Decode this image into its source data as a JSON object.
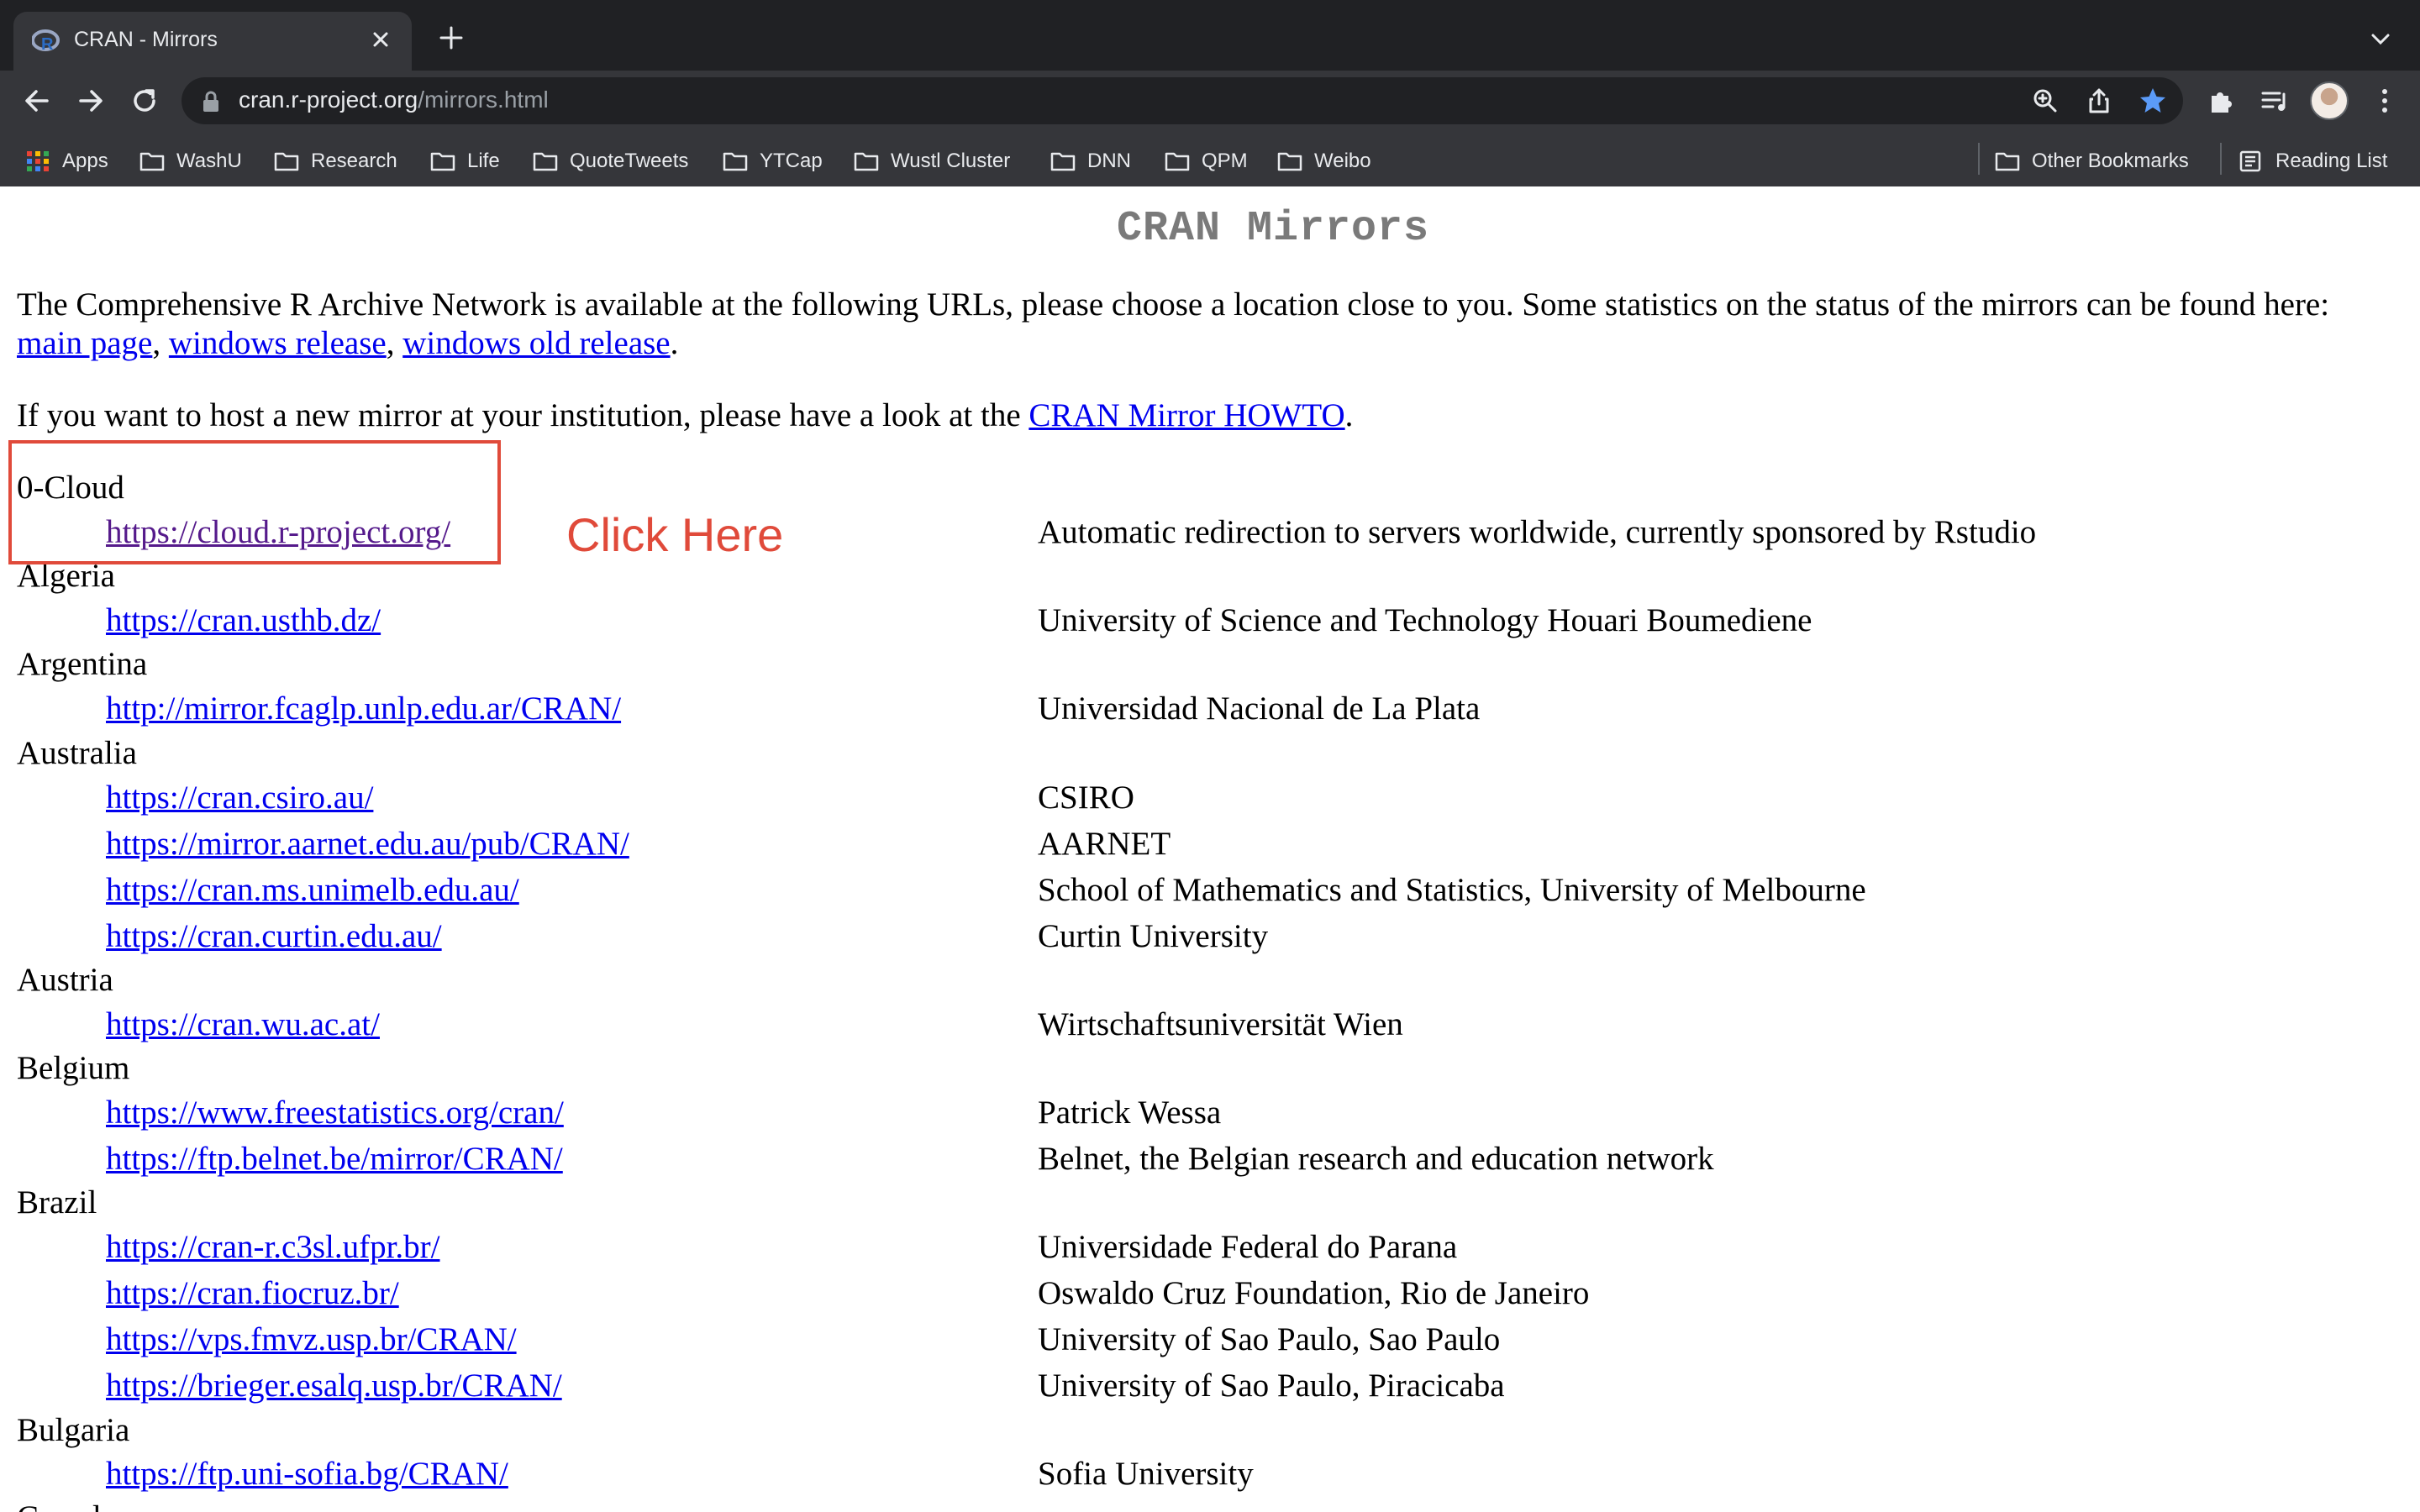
{
  "browser": {
    "tab_title": "CRAN - Mirrors",
    "url_host": "cran.r-project.org",
    "url_path": "/mirrors.html",
    "bookmarks": [
      "Apps",
      "WashU",
      "Research",
      "Life",
      "QuoteTweets",
      "YTCap",
      "Wustl Cluster",
      "DNN",
      "QPM",
      "Weibo"
    ],
    "other_bookmarks": "Other Bookmarks",
    "reading_list": "Reading List"
  },
  "page": {
    "title": "CRAN Mirrors",
    "intro_text": "The Comprehensive R Archive Network is available at the following URLs, please choose a location close to you. Some statistics on the status of the mirrors can be found here:",
    "stats_links": [
      "main page",
      "windows release",
      "windows old release"
    ],
    "howto_prefix": "If you want to host a new mirror at your institution, please have a look at the",
    "howto_link": "CRAN Mirror HOWTO",
    "annotation": "Click Here"
  },
  "mirrors": [
    {
      "country": "0-Cloud",
      "entries": [
        {
          "url": "https://cloud.r-project.org/",
          "desc": "Automatic redirection to servers worldwide, currently sponsored by Rstudio"
        }
      ]
    },
    {
      "country": "Algeria",
      "entries": [
        {
          "url": "https://cran.usthb.dz/",
          "desc": "University of Science and Technology Houari Boumediene"
        }
      ]
    },
    {
      "country": "Argentina",
      "entries": [
        {
          "url": "http://mirror.fcaglp.unlp.edu.ar/CRAN/",
          "desc": "Universidad Nacional de La Plata"
        }
      ]
    },
    {
      "country": "Australia",
      "entries": [
        {
          "url": "https://cran.csiro.au/",
          "desc": "CSIRO"
        },
        {
          "url": "https://mirror.aarnet.edu.au/pub/CRAN/",
          "desc": "AARNET"
        },
        {
          "url": "https://cran.ms.unimelb.edu.au/",
          "desc": "School of Mathematics and Statistics, University of Melbourne"
        },
        {
          "url": "https://cran.curtin.edu.au/",
          "desc": "Curtin University"
        }
      ]
    },
    {
      "country": "Austria",
      "entries": [
        {
          "url": "https://cran.wu.ac.at/",
          "desc": "Wirtschaftsuniversität Wien"
        }
      ]
    },
    {
      "country": "Belgium",
      "entries": [
        {
          "url": "https://www.freestatistics.org/cran/",
          "desc": "Patrick Wessa"
        },
        {
          "url": "https://ftp.belnet.be/mirror/CRAN/",
          "desc": "Belnet, the Belgian research and education network"
        }
      ]
    },
    {
      "country": "Brazil",
      "entries": [
        {
          "url": "https://cran-r.c3sl.ufpr.br/",
          "desc": "Universidade Federal do Parana"
        },
        {
          "url": "https://cran.fiocruz.br/",
          "desc": "Oswaldo Cruz Foundation, Rio de Janeiro"
        },
        {
          "url": "https://vps.fmvz.usp.br/CRAN/",
          "desc": "University of Sao Paulo, Sao Paulo"
        },
        {
          "url": "https://brieger.esalq.usp.br/CRAN/",
          "desc": "University of Sao Paulo, Piracicaba"
        }
      ]
    },
    {
      "country": "Bulgaria",
      "entries": [
        {
          "url": "https://ftp.uni-sofia.bg/CRAN/",
          "desc": "Sofia University"
        }
      ]
    },
    {
      "country": "Canada",
      "entries": []
    }
  ]
}
